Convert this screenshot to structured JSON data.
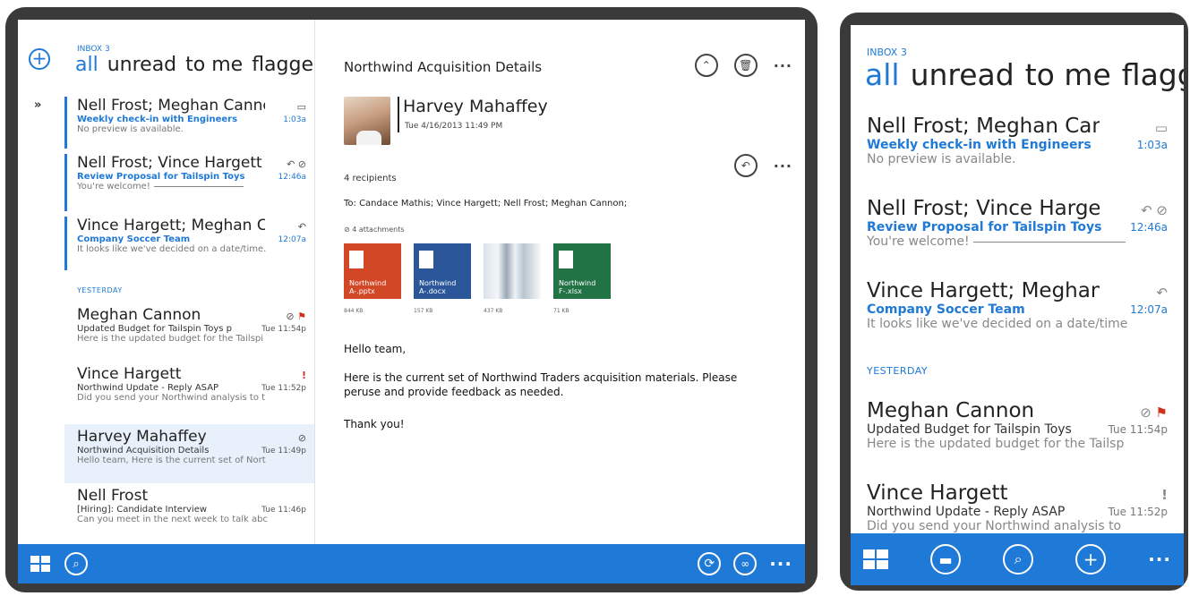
{
  "tablet": {
    "folder_label": "INBOX 3",
    "pivots": [
      "all",
      "unread",
      "to me",
      "flagged"
    ],
    "expand_glyph": "»",
    "messages": [
      {
        "from": "Nell Frost; Meghan Cannon",
        "subject": "Weekly check-in with Engineers",
        "time": "1:03a",
        "preview": "No preview is available.",
        "icons": "▭"
      },
      {
        "from": "Nell Frost; Vince Hargett",
        "subject": "Review Proposal for Tailspin Toys",
        "time": "12:46a",
        "preview": "You're welcome!",
        "icons": "↶ ⊘"
      },
      {
        "from": "Vince Hargett; Meghan Cannon",
        "subject": "Company Soccer Team",
        "time": "12:07a",
        "preview": "It looks like we've decided on a date/time.",
        "icons": "↶"
      },
      {
        "from": "Meghan Cannon",
        "subject": "Updated Budget for Tailspin Toys p",
        "time": "Tue 11:54p",
        "preview": "Here is the updated budget for the Tailspi",
        "icons": "⊘"
      },
      {
        "from": "Vince Hargett",
        "subject": "Northwind Update - Reply ASAP",
        "time": "Tue 11:52p",
        "preview": "Did you send your Northwind analysis to t",
        "icons": "!"
      },
      {
        "from": "Harvey Mahaffey",
        "subject": "Northwind Acquisition Details",
        "time": "Tue 11:49p",
        "preview": "Hello team, Here is the current set of Nort",
        "icons": "⊘"
      },
      {
        "from": "Nell Frost",
        "subject": "[Hiring]: Candidate Interview",
        "time": "Tue 11:46p",
        "preview": "Can you meet in the next week to talk abc",
        "icons": ""
      }
    ],
    "section_yesterday": "YESTERDAY",
    "reading": {
      "subject": "Northwind Acquisition Details",
      "sender": "Harvey Mahaffey",
      "sent": "Tue 4/16/2013 11:49 PM",
      "recipients_count": "4 recipients",
      "to_line": "To: Candace Mathis; Vince Hargett; Nell Frost; Meghan Cannon;",
      "attachments_label": "4 attachments",
      "attachments": [
        {
          "name": "Northwind A-.pptx",
          "size": "844 KB",
          "color": "#d24726"
        },
        {
          "name": "Northwind A-.docx",
          "size": "157 KB",
          "color": "#2b579a"
        },
        {
          "name": "",
          "size": "437 KB",
          "color": "#cfd8df"
        },
        {
          "name": "Northwind F-.xlsx",
          "size": "71 KB",
          "color": "#217346"
        }
      ],
      "greeting": "Hello team,",
      "body": "Here is the current set of Northwind Traders acquisition materials. Please peruse and provide feedback as needed.",
      "signoff": "Thank you!"
    }
  },
  "phone": {
    "folder_label": "INBOX 3",
    "pivots": [
      "all",
      "unread",
      "to me",
      "flagged"
    ],
    "messages": [
      {
        "from": "Nell Frost; Meghan Cannon",
        "subject": "Weekly check-in with Engineers",
        "time": "1:03a",
        "preview": "No preview is available.",
        "icons": "▭"
      },
      {
        "from": "Nell Frost; Vince Hargett",
        "subject": "Review Proposal for Tailspin Toys",
        "time": "12:46a",
        "preview": "You're welcome!",
        "icons": "↶ ⊘"
      },
      {
        "from": "Vince Hargett; Meghan Cannon",
        "subject": "Company Soccer Team",
        "time": "12:07a",
        "preview": "It looks like we've decided on a date/time",
        "icons": "↶"
      },
      {
        "from": "Meghan Cannon",
        "subject": "Updated Budget for Tailspin Toys",
        "time": "Tue 11:54p",
        "preview": "Here is the updated budget for the Tailsp",
        "icons": "⊘"
      },
      {
        "from": "Vince Hargett",
        "subject": "Northwind Update - Reply ASAP",
        "time": "Tue 11:52p",
        "preview": "Did you send your Northwind analysis to",
        "icons": "!"
      }
    ],
    "section_yesterday": "YESTERDAY"
  },
  "colors": {
    "accent": "#1f79d6",
    "flag": "#d0301a",
    "bezel": "#3a3a3a"
  },
  "icons": {
    "new": "plus-circle-icon",
    "folders": "tiles-icon",
    "search": "search-icon",
    "sync": "sync-icon",
    "more": "more-icon",
    "reply": "reply-icon",
    "delete": "delete-icon",
    "attachment": "paperclip-icon",
    "flag": "flag-icon",
    "important": "exclamation-icon"
  }
}
